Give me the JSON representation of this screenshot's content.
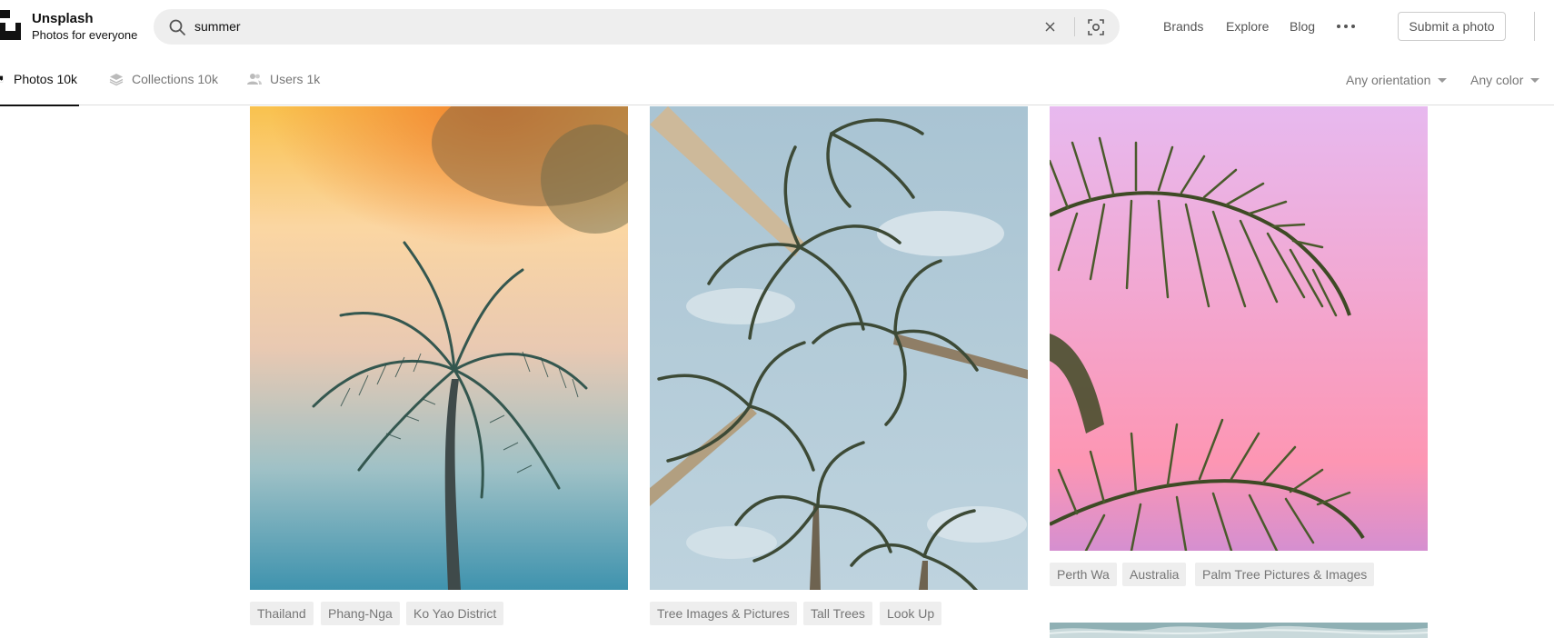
{
  "header": {
    "logo_title": "Unsplash",
    "logo_subtitle": "Photos for everyone",
    "search_value": "summer",
    "nav": [
      "Brands",
      "Explore",
      "Blog"
    ],
    "submit_label": "Submit a photo"
  },
  "tabs": [
    {
      "label": "Photos 10k",
      "icon": "photo-icon",
      "active": true
    },
    {
      "label": "Collections 10k",
      "icon": "collections-icon",
      "active": false
    },
    {
      "label": "Users 1k",
      "icon": "users-icon",
      "active": false
    }
  ],
  "filters": {
    "orientation": "Any orientation",
    "color": "Any color"
  },
  "photos": [
    {
      "subject": "palm tree against orange-blue sunset sky",
      "tags": [
        "Thailand",
        "Phang-Nga",
        "Ko Yao District"
      ]
    },
    {
      "subject": "tall coconut palms looking up into blue sky",
      "tags": [
        "Tree Images & Pictures",
        "Tall Trees",
        "Look Up"
      ]
    },
    {
      "subject": "palm fronds against pink sky",
      "tags": [
        "Perth Wa",
        "Australia",
        "Palm Tree Pictures & Images"
      ]
    },
    {
      "subject": "ocean wave (partially visible)",
      "tags": []
    }
  ]
}
